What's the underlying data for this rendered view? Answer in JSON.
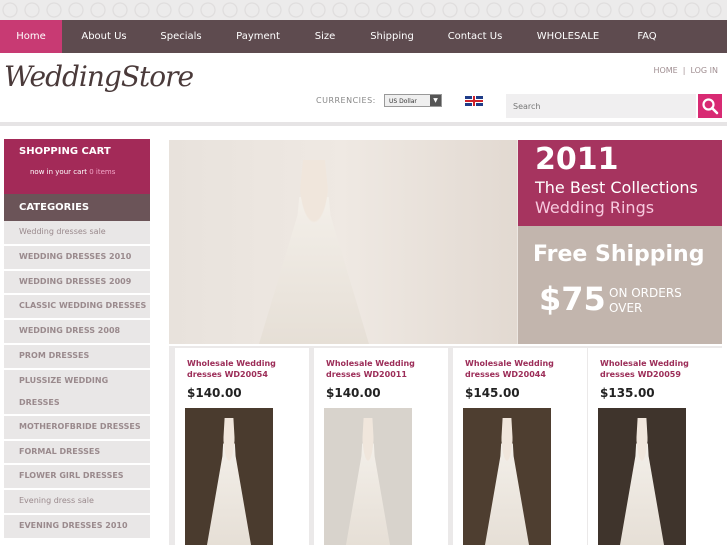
{
  "nav": {
    "items": [
      {
        "label": "Home"
      },
      {
        "label": "About Us"
      },
      {
        "label": "Specials"
      },
      {
        "label": "Payment"
      },
      {
        "label": "Size"
      },
      {
        "label": "Shipping"
      },
      {
        "label": "Contact Us"
      },
      {
        "label": "WHOLESALE"
      },
      {
        "label": "FAQ"
      }
    ]
  },
  "header": {
    "logo_text": "WeddingStore",
    "links": {
      "home": "HOME",
      "separator": "|",
      "login": "LOG IN"
    },
    "currency_label": "CURRENCIES:",
    "currency_value": "US Dollar",
    "search_placeholder": "Search"
  },
  "sidebar": {
    "cart": {
      "title": "SHOPPING CART",
      "subtitle": "now in your cart",
      "count": "0 items"
    },
    "categories_title": "CATEGORIES",
    "categories": [
      "Wedding dresses sale",
      "WEDDING DRESSES 2010",
      "WEDDING DRESSES 2009",
      "CLASSIC WEDDING DRESSES",
      "WEDDING DRESS 2008",
      "PROM DRESSES",
      "PLUSSIZE WEDDING DRESSES",
      "MOTHEROFBRIDE DRESSES",
      "FORMAL DRESSES",
      "FLOWER GIRL DRESSES",
      "Evening dress sale",
      "EVENING DRESSES 2010"
    ]
  },
  "banner": {
    "year": "2011",
    "line1": "The Best Collections",
    "line2": "Wedding Rings",
    "free_shipping": "Free Shipping",
    "price": "$75",
    "on_orders": "ON ORDERS",
    "over": "OVER"
  },
  "products": [
    {
      "name": "Wholesale Wedding dresses WD20054",
      "price": "$140.00"
    },
    {
      "name": "Wholesale Wedding dresses WD20011",
      "price": "$140.00"
    },
    {
      "name": "Wholesale Wedding dresses WD20044",
      "price": "$145.00"
    },
    {
      "name": "Wholesale Wedding dresses WD20059",
      "price": "$135.00"
    }
  ],
  "colors": {
    "accent": "#c83a73",
    "nav_bg": "#5e4b4f",
    "cart_bg": "#a32a58"
  }
}
